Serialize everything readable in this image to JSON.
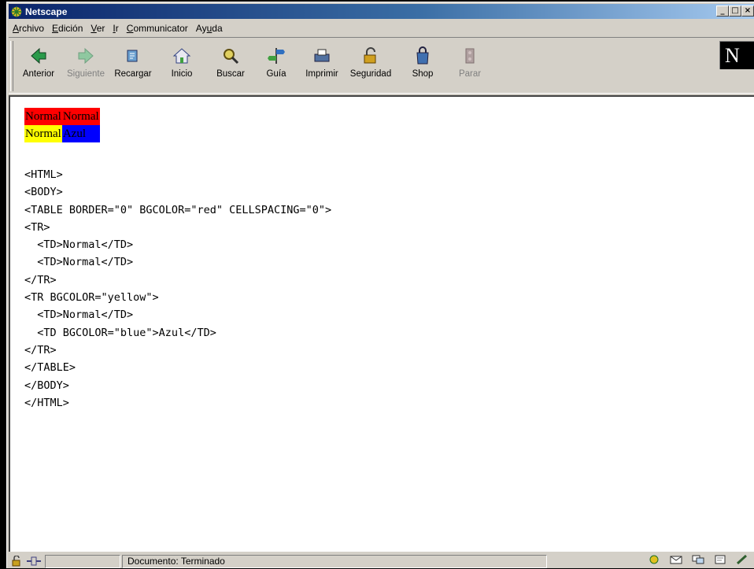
{
  "window": {
    "title": "Netscape"
  },
  "menu": [
    "Archivo",
    "Edición",
    "Ver",
    "Ir",
    "Communicator",
    "Ayuda"
  ],
  "menu_underline": [
    "A",
    "E",
    "V",
    "I",
    "C",
    "u"
  ],
  "toolbar": [
    {
      "label": "Anterior",
      "icon": "back-arrow-icon",
      "enabled": true
    },
    {
      "label": "Siguiente",
      "icon": "forward-arrow-icon",
      "enabled": false
    },
    {
      "label": "Recargar",
      "icon": "reload-icon",
      "enabled": true
    },
    {
      "label": "Inicio",
      "icon": "home-icon",
      "enabled": true
    },
    {
      "label": "Buscar",
      "icon": "search-icon",
      "enabled": true
    },
    {
      "label": "Guía",
      "icon": "guide-icon",
      "enabled": true
    },
    {
      "label": "Imprimir",
      "icon": "print-icon",
      "enabled": true
    },
    {
      "label": "Seguridad",
      "icon": "lock-icon",
      "enabled": true
    },
    {
      "label": "Shop",
      "icon": "shop-icon",
      "enabled": true
    },
    {
      "label": "Parar",
      "icon": "stop-icon",
      "enabled": false
    }
  ],
  "logo": {
    "text": "N"
  },
  "demo_table": {
    "row1": [
      "Normal",
      "Normal"
    ],
    "row2": [
      "Normal",
      "Azul"
    ]
  },
  "source_lines": [
    "<HTML>",
    "<BODY>",
    "<TABLE BORDER=\"0\" BGCOLOR=\"red\" CELLSPACING=\"0\">",
    "<TR>",
    "  <TD>Normal</TD>",
    "  <TD>Normal</TD>",
    "</TR>",
    "<TR BGCOLOR=\"yellow\">",
    "  <TD>Normal</TD>",
    "  <TD BGCOLOR=\"blue\">Azul</TD>",
    "</TR>",
    "</TABLE>",
    "</BODY>",
    "</HTML>"
  ],
  "status": {
    "text": "Documento: Terminado"
  },
  "colors": {
    "title_start": "#0a246a",
    "title_end": "#a6caf0",
    "chrome": "#d4d0c8",
    "red": "#ff0000",
    "yellow": "#ffff00",
    "blue": "#0000ff"
  }
}
